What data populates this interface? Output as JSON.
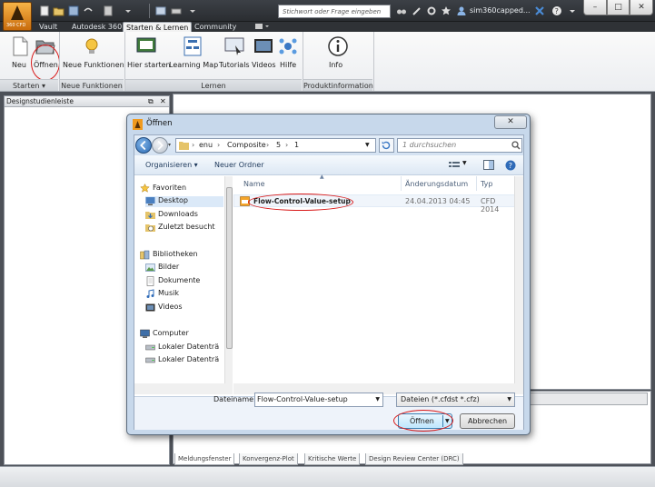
{
  "app": {
    "badge": "360 CFD",
    "search_placeholder": "Stichwort oder Frage eingeben",
    "username": "sim360capped...",
    "window_controls": {
      "minimize": "–",
      "maximize": "□",
      "close": "✕"
    }
  },
  "ribbon": {
    "tabs": [
      "Vault",
      "Autodesk 360",
      "Starten & Lernen",
      "Community"
    ],
    "active_tab": "Starten & Lernen",
    "buttons": {
      "new": "Neu",
      "open": "Öffnen",
      "new_features": "Neue Funktionen",
      "start_here": "Hier starten",
      "learning_map": "Learning Map",
      "tutorials": "Tutorials",
      "videos": "Videos",
      "help": "Hilfe",
      "info": "Info"
    },
    "groups": {
      "start": "Starten",
      "new_features": "Neue Funktionen",
      "learn": "Lernen",
      "product_info": "Produktinformation"
    }
  },
  "left_panel": {
    "title": "Designstudienleiste"
  },
  "bottom_tabs": [
    "Meldungsfenster",
    "Konvergenz-Plot",
    "Kritische Werte",
    "Design Review Center (DRC)"
  ],
  "dialog": {
    "title": "Öffnen",
    "address": [
      "enu",
      "Composite",
      "5",
      "1"
    ],
    "search_placeholder": "1 durchsuchen",
    "organize": "Organisieren",
    "new_folder": "Neuer Ordner",
    "nav": {
      "favorites": "Favoriten",
      "desktop": "Desktop",
      "downloads": "Downloads",
      "recent": "Zuletzt besucht",
      "libraries": "Bibliotheken",
      "pictures": "Bilder",
      "documents": "Dokumente",
      "music": "Musik",
      "videos": "Videos",
      "computer": "Computer",
      "local1": "Lokaler Datenträ",
      "local2": "Lokaler Datenträ"
    },
    "columns": {
      "name": "Name",
      "date": "Änderungsdatum",
      "type": "Typ"
    },
    "files": [
      {
        "name": "Flow-Control-Value-setup",
        "date": "24.04.2013 04:45",
        "type": "CFD 2014"
      }
    ],
    "filename_label": "Dateiname:",
    "filename_value": "Flow-Control-Value-setup",
    "filetype": "Dateien (*.cfdst *.cfz)",
    "open_button": "Öffnen",
    "cancel_button": "Abbrechen",
    "close": "✕"
  },
  "colors": {
    "highlight_oval": "#d81818",
    "accent": "#f0a030"
  }
}
